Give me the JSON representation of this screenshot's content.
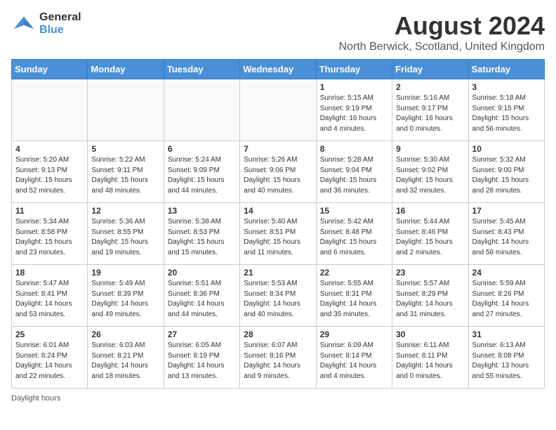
{
  "header": {
    "logo_general": "General",
    "logo_blue": "Blue",
    "main_title": "August 2024",
    "subtitle": "North Berwick, Scotland, United Kingdom"
  },
  "days_of_week": [
    "Sunday",
    "Monday",
    "Tuesday",
    "Wednesday",
    "Thursday",
    "Friday",
    "Saturday"
  ],
  "weeks": [
    [
      {
        "day": "",
        "info": ""
      },
      {
        "day": "",
        "info": ""
      },
      {
        "day": "",
        "info": ""
      },
      {
        "day": "",
        "info": ""
      },
      {
        "day": "1",
        "info": "Sunrise: 5:15 AM\nSunset: 9:19 PM\nDaylight: 16 hours\nand 4 minutes."
      },
      {
        "day": "2",
        "info": "Sunrise: 5:16 AM\nSunset: 9:17 PM\nDaylight: 16 hours\nand 0 minutes."
      },
      {
        "day": "3",
        "info": "Sunrise: 5:18 AM\nSunset: 9:15 PM\nDaylight: 15 hours\nand 56 minutes."
      }
    ],
    [
      {
        "day": "4",
        "info": "Sunrise: 5:20 AM\nSunset: 9:13 PM\nDaylight: 15 hours\nand 52 minutes."
      },
      {
        "day": "5",
        "info": "Sunrise: 5:22 AM\nSunset: 9:11 PM\nDaylight: 15 hours\nand 48 minutes."
      },
      {
        "day": "6",
        "info": "Sunrise: 5:24 AM\nSunset: 9:09 PM\nDaylight: 15 hours\nand 44 minutes."
      },
      {
        "day": "7",
        "info": "Sunrise: 5:26 AM\nSunset: 9:06 PM\nDaylight: 15 hours\nand 40 minutes."
      },
      {
        "day": "8",
        "info": "Sunrise: 5:28 AM\nSunset: 9:04 PM\nDaylight: 15 hours\nand 36 minutes."
      },
      {
        "day": "9",
        "info": "Sunrise: 5:30 AM\nSunset: 9:02 PM\nDaylight: 15 hours\nand 32 minutes."
      },
      {
        "day": "10",
        "info": "Sunrise: 5:32 AM\nSunset: 9:00 PM\nDaylight: 15 hours\nand 28 minutes."
      }
    ],
    [
      {
        "day": "11",
        "info": "Sunrise: 5:34 AM\nSunset: 8:58 PM\nDaylight: 15 hours\nand 23 minutes."
      },
      {
        "day": "12",
        "info": "Sunrise: 5:36 AM\nSunset: 8:55 PM\nDaylight: 15 hours\nand 19 minutes."
      },
      {
        "day": "13",
        "info": "Sunrise: 5:38 AM\nSunset: 8:53 PM\nDaylight: 15 hours\nand 15 minutes."
      },
      {
        "day": "14",
        "info": "Sunrise: 5:40 AM\nSunset: 8:51 PM\nDaylight: 15 hours\nand 11 minutes."
      },
      {
        "day": "15",
        "info": "Sunrise: 5:42 AM\nSunset: 8:48 PM\nDaylight: 15 hours\nand 6 minutes."
      },
      {
        "day": "16",
        "info": "Sunrise: 5:44 AM\nSunset: 8:46 PM\nDaylight: 15 hours\nand 2 minutes."
      },
      {
        "day": "17",
        "info": "Sunrise: 5:45 AM\nSunset: 8:43 PM\nDaylight: 14 hours\nand 58 minutes."
      }
    ],
    [
      {
        "day": "18",
        "info": "Sunrise: 5:47 AM\nSunset: 8:41 PM\nDaylight: 14 hours\nand 53 minutes."
      },
      {
        "day": "19",
        "info": "Sunrise: 5:49 AM\nSunset: 8:39 PM\nDaylight: 14 hours\nand 49 minutes."
      },
      {
        "day": "20",
        "info": "Sunrise: 5:51 AM\nSunset: 8:36 PM\nDaylight: 14 hours\nand 44 minutes."
      },
      {
        "day": "21",
        "info": "Sunrise: 5:53 AM\nSunset: 8:34 PM\nDaylight: 14 hours\nand 40 minutes."
      },
      {
        "day": "22",
        "info": "Sunrise: 5:55 AM\nSunset: 8:31 PM\nDaylight: 14 hours\nand 35 minutes."
      },
      {
        "day": "23",
        "info": "Sunrise: 5:57 AM\nSunset: 8:29 PM\nDaylight: 14 hours\nand 31 minutes."
      },
      {
        "day": "24",
        "info": "Sunrise: 5:59 AM\nSunset: 8:26 PM\nDaylight: 14 hours\nand 27 minutes."
      }
    ],
    [
      {
        "day": "25",
        "info": "Sunrise: 6:01 AM\nSunset: 8:24 PM\nDaylight: 14 hours\nand 22 minutes."
      },
      {
        "day": "26",
        "info": "Sunrise: 6:03 AM\nSunset: 8:21 PM\nDaylight: 14 hours\nand 18 minutes."
      },
      {
        "day": "27",
        "info": "Sunrise: 6:05 AM\nSunset: 8:19 PM\nDaylight: 14 hours\nand 13 minutes."
      },
      {
        "day": "28",
        "info": "Sunrise: 6:07 AM\nSunset: 8:16 PM\nDaylight: 14 hours\nand 9 minutes."
      },
      {
        "day": "29",
        "info": "Sunrise: 6:09 AM\nSunset: 8:14 PM\nDaylight: 14 hours\nand 4 minutes."
      },
      {
        "day": "30",
        "info": "Sunrise: 6:11 AM\nSunset: 8:11 PM\nDaylight: 14 hours\nand 0 minutes."
      },
      {
        "day": "31",
        "info": "Sunrise: 6:13 AM\nSunset: 8:08 PM\nDaylight: 13 hours\nand 55 minutes."
      }
    ]
  ],
  "footer": {
    "daylight_label": "Daylight hours"
  }
}
